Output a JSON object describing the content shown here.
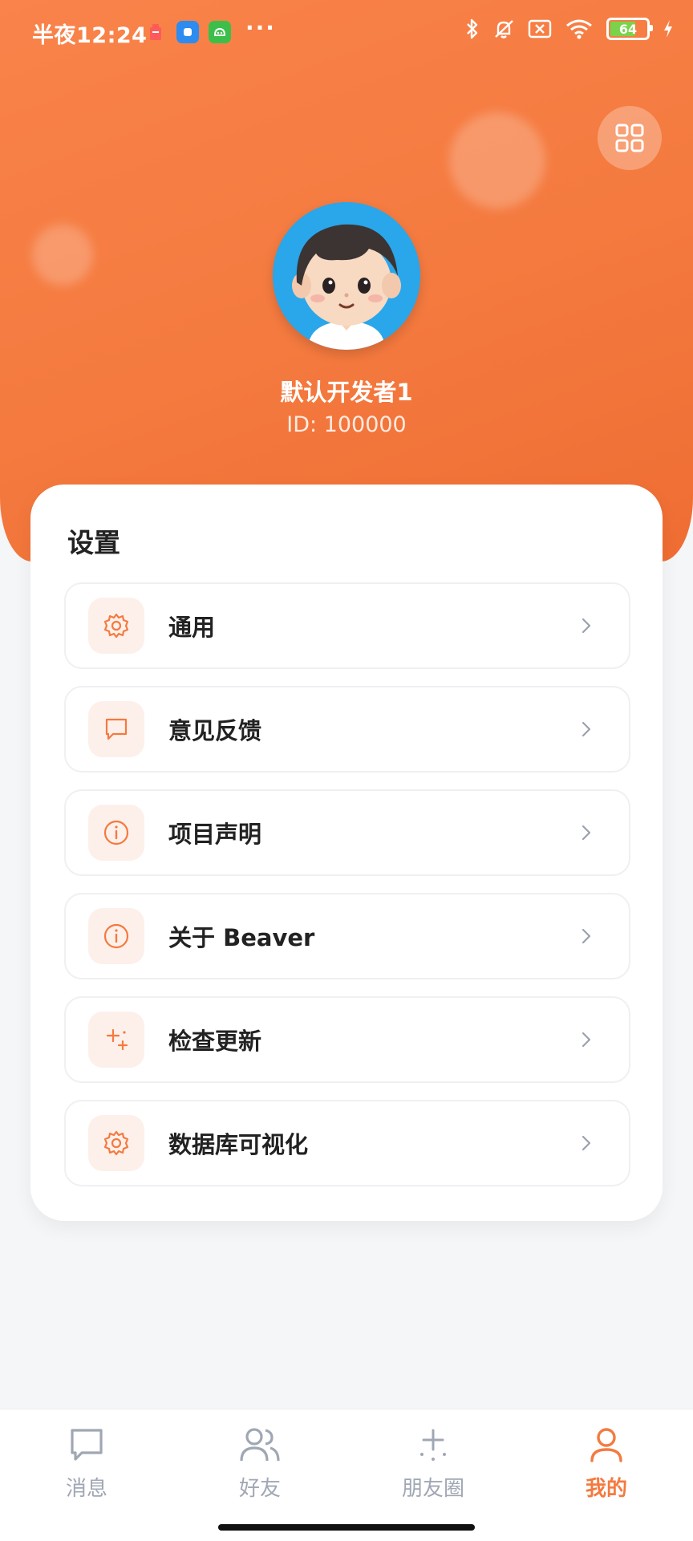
{
  "status_bar": {
    "time": "半夜12:24",
    "battery_level": "64"
  },
  "profile": {
    "name": "默认开发者1",
    "id_text": "ID: 100000"
  },
  "settings": {
    "title": "设置",
    "items": [
      {
        "label": "通用",
        "icon": "gear-icon"
      },
      {
        "label": "意见反馈",
        "icon": "message-icon"
      },
      {
        "label": "项目声明",
        "icon": "info-icon"
      },
      {
        "label": "关于 Beaver",
        "icon": "info-icon"
      },
      {
        "label": "检查更新",
        "icon": "sparkle-icon"
      },
      {
        "label": "数据库可视化",
        "icon": "gear-icon"
      }
    ]
  },
  "tabbar": {
    "tabs": [
      {
        "label": "消息",
        "icon": "chat-icon"
      },
      {
        "label": "好友",
        "icon": "users-icon"
      },
      {
        "label": "朋友圈",
        "icon": "sparkle-icon"
      },
      {
        "label": "我的",
        "icon": "user-icon",
        "active": true
      }
    ]
  },
  "colors": {
    "accent": "#f47a3f",
    "icon_bg": "#fdf0ea",
    "tab_inactive": "#a0a7b4"
  }
}
